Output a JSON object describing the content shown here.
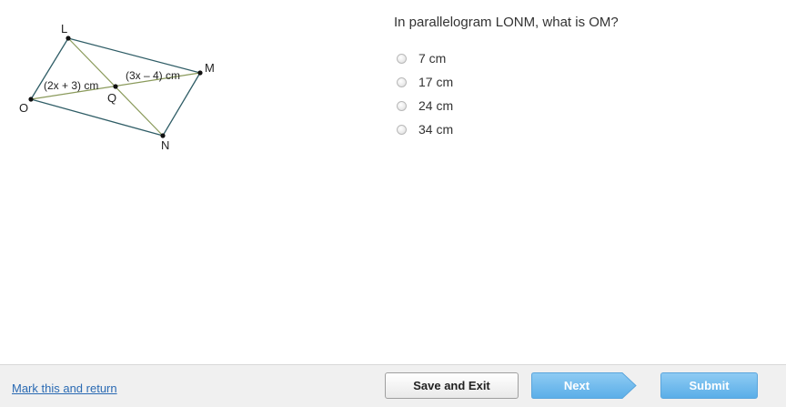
{
  "figure": {
    "vertex_labels": {
      "L": "L",
      "M": "M",
      "N": "N",
      "O": "O",
      "Q": "Q"
    },
    "segment_labels": {
      "OQ": "(2x + 3) cm",
      "QM": "(3x – 4) cm"
    },
    "colors": {
      "parallelogram": "#2f5d66",
      "diagonal": "#8a9a5b"
    }
  },
  "question": {
    "text": "In parallelogram LONM, what is OM?",
    "options": [
      {
        "label": "7 cm"
      },
      {
        "label": "17 cm"
      },
      {
        "label": "24 cm"
      },
      {
        "label": "34 cm"
      }
    ]
  },
  "footer": {
    "mark_link": "Mark this and return",
    "save_label": "Save and Exit",
    "next_label": "Next",
    "submit_label": "Submit"
  }
}
